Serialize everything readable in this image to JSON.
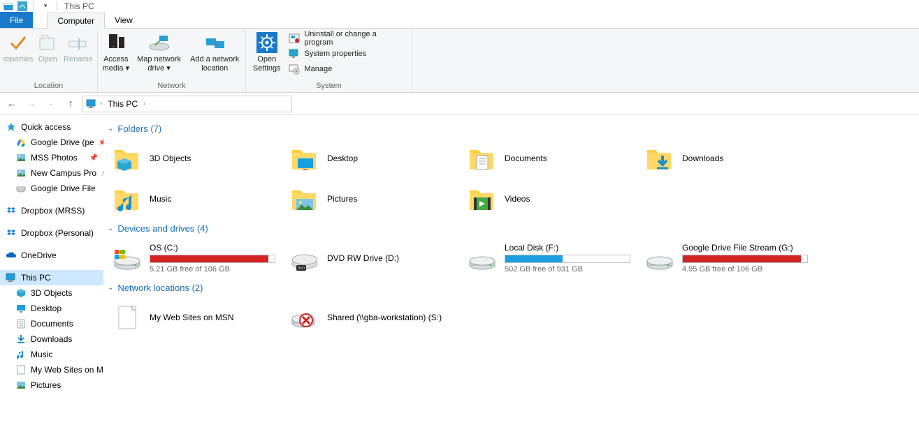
{
  "title": "This PC",
  "tabs": {
    "file": "File",
    "computer": "Computer",
    "view": "View"
  },
  "ribbon": {
    "location": {
      "label": "Location",
      "properties": "roperties",
      "open": "Open",
      "rename": "Rename"
    },
    "network": {
      "label": "Network",
      "access_media": "Access media",
      "map_drive": "Map network drive",
      "add_location": "Add a network location"
    },
    "system": {
      "label": "System",
      "open_settings": "Open Settings",
      "uninstall": "Uninstall or change a program",
      "sys_props": "System properties",
      "manage": "Manage"
    }
  },
  "breadcrumb": {
    "root": "This PC"
  },
  "sidebar": {
    "quick_access": "Quick access",
    "qa_items": [
      "Google Drive (pe",
      "MSS Photos",
      "New Campus Pro",
      "Google Drive File"
    ],
    "dropbox_mrss": "Dropbox (MRSS)",
    "dropbox_personal": "Dropbox (Personal)",
    "onedrive": "OneDrive",
    "this_pc": "This PC",
    "pc_items": [
      "3D Objects",
      "Desktop",
      "Documents",
      "Downloads",
      "Music",
      "My Web Sites on M",
      "Pictures"
    ]
  },
  "sections": {
    "folders": {
      "title": "Folders (7)",
      "items": [
        "3D Objects",
        "Desktop",
        "Documents",
        "Downloads",
        "Music",
        "Pictures",
        "Videos"
      ]
    },
    "drives": {
      "title": "Devices and drives (4)",
      "items": [
        {
          "name": "OS (C:)",
          "sub": "5.21 GB free of 106 GB",
          "pct": 95,
          "color": "#d32323"
        },
        {
          "name": "DVD RW Drive (D:)",
          "sub": "",
          "pct": -1,
          "color": ""
        },
        {
          "name": "Local Disk (F:)",
          "sub": "502 GB free of 931 GB",
          "pct": 46,
          "color": "#1a9fe0"
        },
        {
          "name": "Google Drive File Stream (G:)",
          "sub": "4.95 GB free of 106 GB",
          "pct": 95,
          "color": "#d32323"
        }
      ]
    },
    "network": {
      "title": "Network locations (2)",
      "items": [
        "My Web Sites on MSN",
        "Shared (\\\\gba-workstation) (S:)"
      ]
    }
  }
}
